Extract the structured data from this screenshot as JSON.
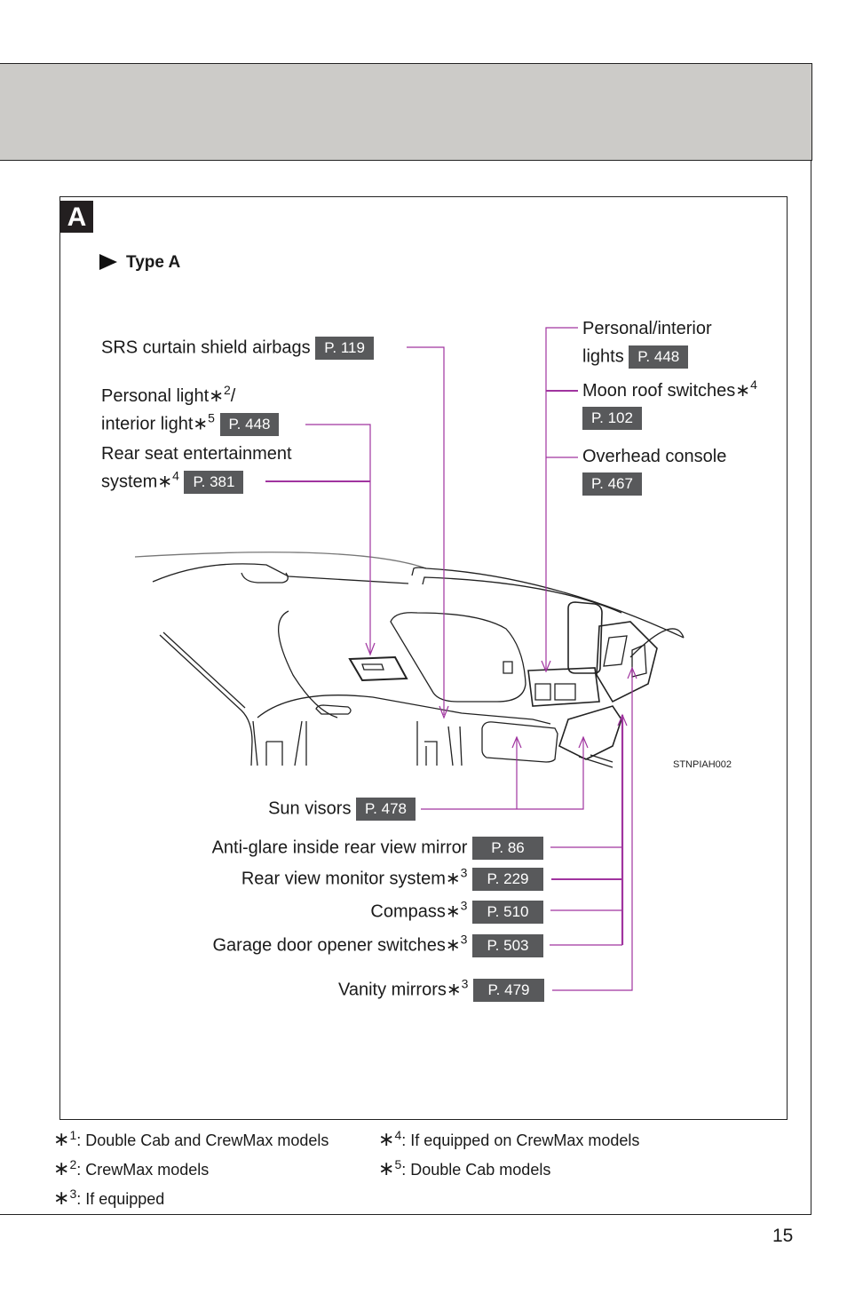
{
  "section": {
    "letter": "A",
    "type_heading": "Type A"
  },
  "callouts_top_left": [
    {
      "label": "SRS curtain shield airbags",
      "page": "P. 119"
    },
    {
      "label_line1": "Personal light",
      "sup1": "2",
      "line1_suffix": "/",
      "label_line2": "interior light",
      "sup2": "5",
      "page": "P. 448"
    },
    {
      "label_line1": "Rear seat entertainment",
      "label_line2": "system",
      "sup": "4",
      "page": "P. 381"
    }
  ],
  "callouts_top_right": [
    {
      "label_line1": "Personal/interior",
      "label_line2": "lights",
      "page": "P. 448"
    },
    {
      "label": "Moon roof switches",
      "sup": "4",
      "page": "P. 102"
    },
    {
      "label": "Overhead console",
      "page": "P. 467"
    }
  ],
  "callouts_bottom": [
    {
      "label": "Sun visors",
      "page": "P. 478"
    },
    {
      "label": "Anti-glare inside rear view mirror",
      "page": "P. 86"
    },
    {
      "label": "Rear view monitor system",
      "sup": "3",
      "page": "P. 229"
    },
    {
      "label": "Compass",
      "sup": "3",
      "page": "P. 510"
    },
    {
      "label": "Garage door opener switches",
      "sup": "3",
      "page": "P. 503"
    },
    {
      "label": "Vanity mirrors",
      "sup": "3",
      "page": "P. 479"
    }
  ],
  "illustration_code": "STNPIAH002",
  "asterisk": "∗",
  "footnotes": [
    {
      "num": "1",
      "text": ": Double Cab and CrewMax models"
    },
    {
      "num": "2",
      "text": ": CrewMax models"
    },
    {
      "num": "3",
      "text": ": If equipped"
    },
    {
      "num": "4",
      "text": ": If equipped on CrewMax models"
    },
    {
      "num": "5",
      "text": ": Double Cab models"
    }
  ],
  "page_number": "15",
  "colors": {
    "leader": "#a0349f",
    "page_badge": "#58595b",
    "header_band": "#cccbc8"
  }
}
